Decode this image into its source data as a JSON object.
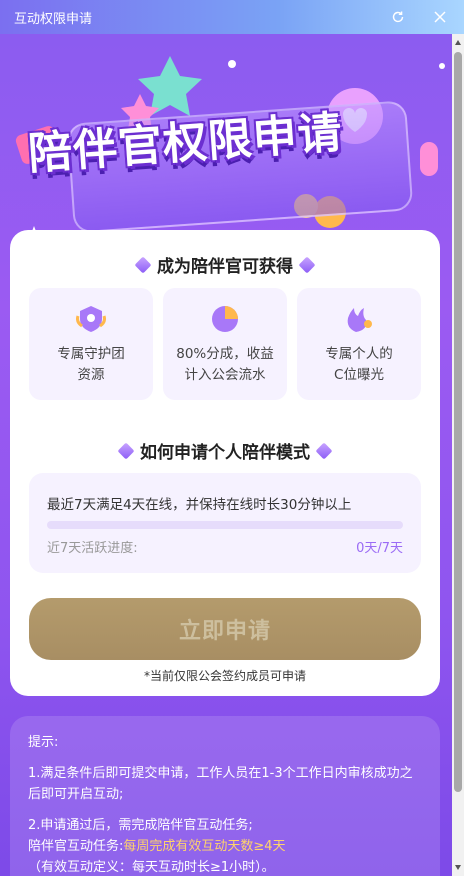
{
  "window": {
    "title": "互动权限申请",
    "refresh_icon": "refresh-icon",
    "close_icon": "close-icon"
  },
  "banner": {
    "title": "陪伴官权限申请"
  },
  "benefits": {
    "title": "成为陪伴官可获得",
    "items": [
      {
        "icon": "shield-badge-icon",
        "line1": "专属守护团",
        "line2": "资源"
      },
      {
        "icon": "pie-chart-icon",
        "line1": "80%分成，收益",
        "line2": "计入公会流水"
      },
      {
        "icon": "flame-sun-icon",
        "line1": "专属个人的",
        "line2": "C位曝光"
      }
    ]
  },
  "howto": {
    "title": "如何申请个人陪伴模式",
    "requirement": "最近7天满足4天在线，并保持在线时长30分钟以上",
    "progress_label": "近7天活跃进度:",
    "progress_value": "0天/7天",
    "progress_fraction": 0
  },
  "apply": {
    "button_label": "立即申请",
    "note": "*当前仅限公会签约成员可申请"
  },
  "tips": {
    "heading": "提示:",
    "item1": "1.满足条件后即可提交申请，工作人员在1-3个工作日内审核成功之后即可开启互动;",
    "item2_line1": "2.申请通过后，需完成陪伴官互动任务;",
    "item2_line2_prefix": "陪伴官互动任务:",
    "item2_line2_highlight": "每周完成有效互动天数≥4天",
    "item2_line3": "（有效互动定义：每天互动时长≥1小时）。"
  },
  "colors": {
    "accent": "#9b6cf5",
    "button": "#a88e63",
    "highlight": "#ffd36b"
  }
}
